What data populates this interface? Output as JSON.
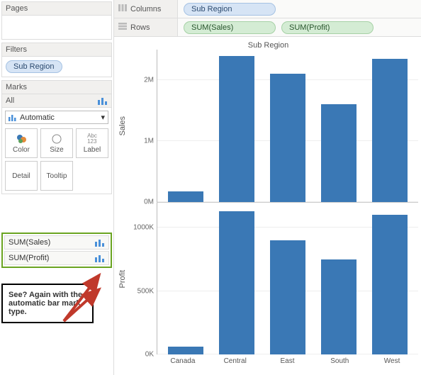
{
  "sidebar": {
    "pages_label": "Pages",
    "filters_label": "Filters",
    "filter_pill": "Sub Region",
    "marks_label": "Marks",
    "marks_all": "All",
    "marks_mode": "Automatic",
    "buttons": {
      "color": "Color",
      "size": "Size",
      "label": "Label",
      "detail": "Detail",
      "tooltip": "Tooltip"
    },
    "highlights": [
      "SUM(Sales)",
      "SUM(Profit)"
    ],
    "callout_text": "See?  Again with the automatic bar mark type."
  },
  "shelves": {
    "columns_label": "Columns",
    "rows_label": "Rows",
    "columns_pill": "Sub Region",
    "rows_pills": [
      "SUM(Sales)",
      "SUM(Profit)"
    ]
  },
  "chart": {
    "title": "Sub Region",
    "y1_label": "Sales",
    "y2_label": "Profit",
    "categories": [
      "Canada",
      "Central",
      "East",
      "South",
      "West"
    ]
  },
  "chart_data": [
    {
      "type": "bar",
      "title": "Sub Region",
      "ylabel": "Sales",
      "ylim": [
        0,
        2500000
      ],
      "ticks": [
        "0M",
        "1M",
        "2M"
      ],
      "categories": [
        "Canada",
        "Central",
        "East",
        "South",
        "West"
      ],
      "values": [
        170000,
        2400000,
        2100000,
        1600000,
        2350000
      ]
    },
    {
      "type": "bar",
      "title": "Sub Region",
      "ylabel": "Profit",
      "ylim": [
        0,
        1200000
      ],
      "ticks": [
        "0K",
        "500K",
        "1000K"
      ],
      "categories": [
        "Canada",
        "Central",
        "East",
        "South",
        "West"
      ],
      "values": [
        60000,
        1130000,
        900000,
        750000,
        1100000
      ]
    }
  ]
}
